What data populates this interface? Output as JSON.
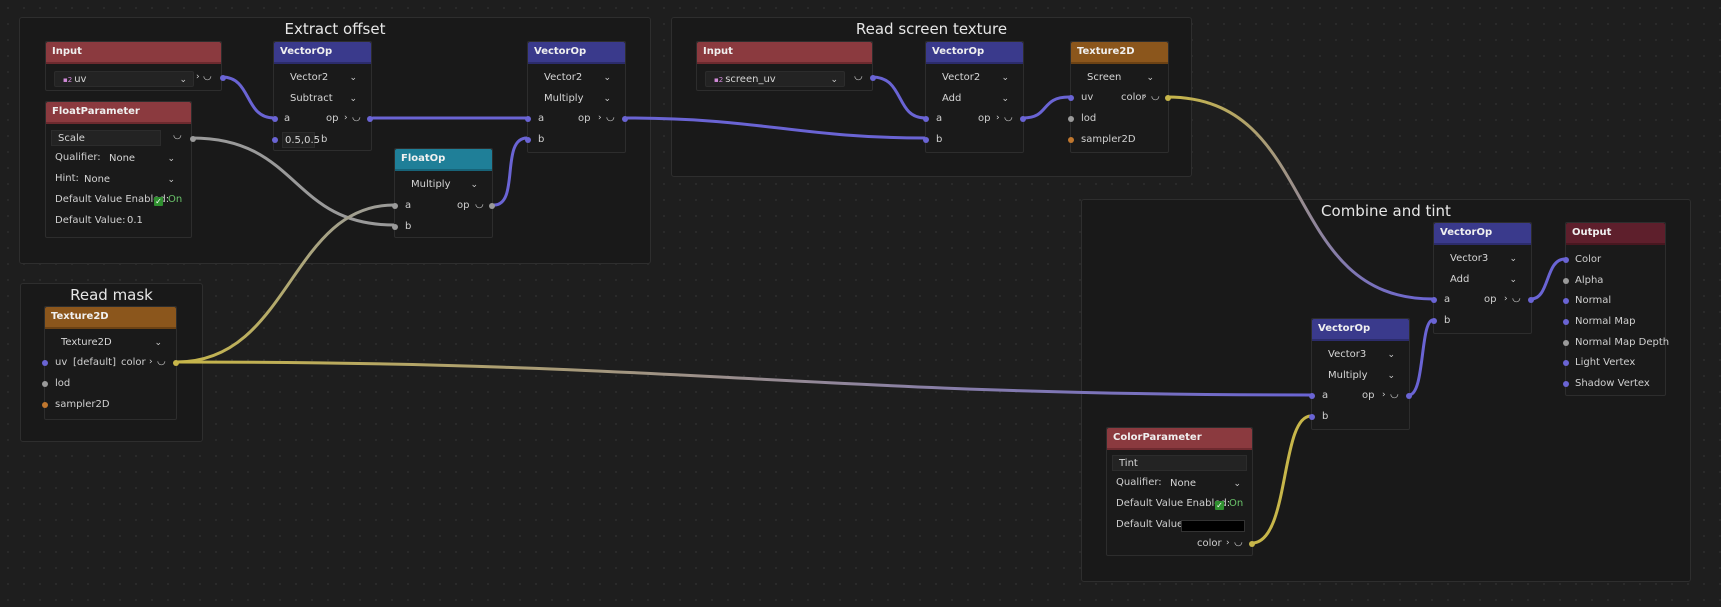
{
  "frames": {
    "extract_offset": "Extract offset",
    "read_screen_texture": "Read screen texture",
    "combine_and_tint": "Combine and tint",
    "read_mask": "Read mask"
  },
  "nodes": {
    "input_uv": {
      "title": "Input",
      "value": "uv",
      "badge": "vec2"
    },
    "float_param": {
      "title": "FloatParameter",
      "name": "Scale",
      "qualifier_label": "Qualifier:",
      "qualifier": "None",
      "hint_label": "Hint:",
      "hint": "None",
      "default_enabled_label": "Default Value Enabled:",
      "default_enabled": "On",
      "default_value_label": "Default Value:",
      "default_value": "0.1"
    },
    "vecop1": {
      "title": "VectorOp",
      "type": "Vector2",
      "op": "Subtract",
      "port_a": "a",
      "port_op": "op",
      "port_b": "b",
      "b_value": "0.5,0.5"
    },
    "floatop": {
      "title": "FloatOp",
      "op": "Multiply",
      "port_a": "a",
      "port_op": "op",
      "port_b": "b"
    },
    "vecop2": {
      "title": "VectorOp",
      "type": "Vector2",
      "op": "Multiply",
      "port_a": "a",
      "port_op": "op",
      "port_b": "b"
    },
    "input_screen_uv": {
      "title": "Input",
      "value": "screen_uv",
      "badge": "vec2"
    },
    "vecop3": {
      "title": "VectorOp",
      "type": "Vector2",
      "op": "Add",
      "port_a": "a",
      "port_op": "op",
      "port_b": "b"
    },
    "tex_screen": {
      "title": "Texture2D",
      "source": "Screen",
      "port_uv": "uv",
      "port_color": "color",
      "port_lod": "lod",
      "port_sampler": "sampler2D"
    },
    "tex_mask": {
      "title": "Texture2D",
      "source": "Texture2D",
      "port_uv": "uv",
      "uv_default": "[default]",
      "port_color": "color",
      "port_lod": "lod",
      "port_sampler": "sampler2D"
    },
    "vecop4": {
      "title": "VectorOp",
      "type": "Vector3",
      "op": "Add",
      "port_a": "a",
      "port_op": "op",
      "port_b": "b"
    },
    "vecop5": {
      "title": "VectorOp",
      "type": "Vector3",
      "op": "Multiply",
      "port_a": "a",
      "port_op": "op",
      "port_b": "b"
    },
    "output": {
      "title": "Output",
      "ports": [
        "Color",
        "Alpha",
        "Normal",
        "Normal Map",
        "Normal Map Depth",
        "Light Vertex",
        "Shadow Vertex"
      ]
    },
    "color_param": {
      "title": "ColorParameter",
      "name": "Tint",
      "qualifier_label": "Qualifier:",
      "qualifier": "None",
      "default_enabled_label": "Default Value Enabled:",
      "default_enabled": "On",
      "default_value_label": "Default Value:",
      "default_color": "#000000",
      "port_color": "color"
    }
  },
  "colors": {
    "vector": "#6a64d4",
    "float": "#9a9a9a",
    "color": "#c7b64a",
    "sampler": "#c0772e"
  },
  "icons": {
    "dropdown": "chevron-down-icon",
    "port_arrow": "chevron-right-icon",
    "connector": "connector-icon",
    "check": "checkbox-icon"
  }
}
